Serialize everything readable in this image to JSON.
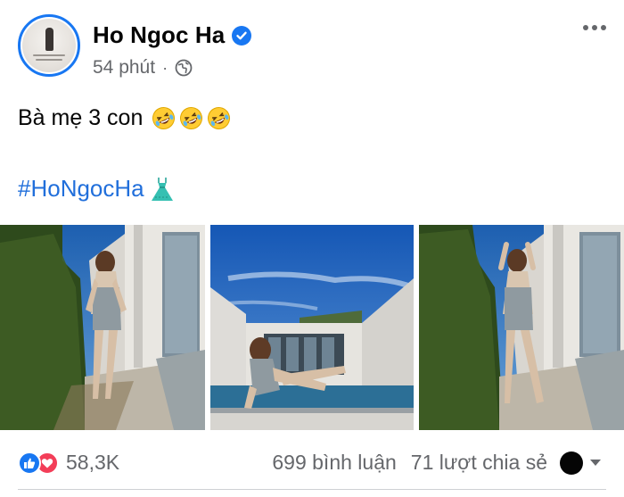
{
  "post": {
    "author": "Ho Ngoc Ha",
    "verified": true,
    "time": "54 phút",
    "separator": "·",
    "audience_icon": "globe-icon",
    "more_icon": "more-options-icon",
    "text": "Bà mẹ 3 con",
    "text_emojis": [
      "rolling-laughing-emoji",
      "rolling-laughing-emoji",
      "rolling-laughing-emoji"
    ],
    "hashtag": "#HoNgocHa",
    "hashtag_emoji": "dress-emoji",
    "photos": [
      {
        "name": "photo-1"
      },
      {
        "name": "photo-2"
      },
      {
        "name": "photo-3"
      }
    ]
  },
  "footer": {
    "reaction_icons": [
      "like-icon",
      "love-icon"
    ],
    "reaction_count": "58,3K",
    "comments": "699 bình luận",
    "shares": "71 lượt chia sẻ"
  },
  "colors": {
    "brand_blue": "#1877f2",
    "hashtag_blue": "#216fdb",
    "love_red": "#f33e58",
    "muted_text": "#65676b"
  }
}
